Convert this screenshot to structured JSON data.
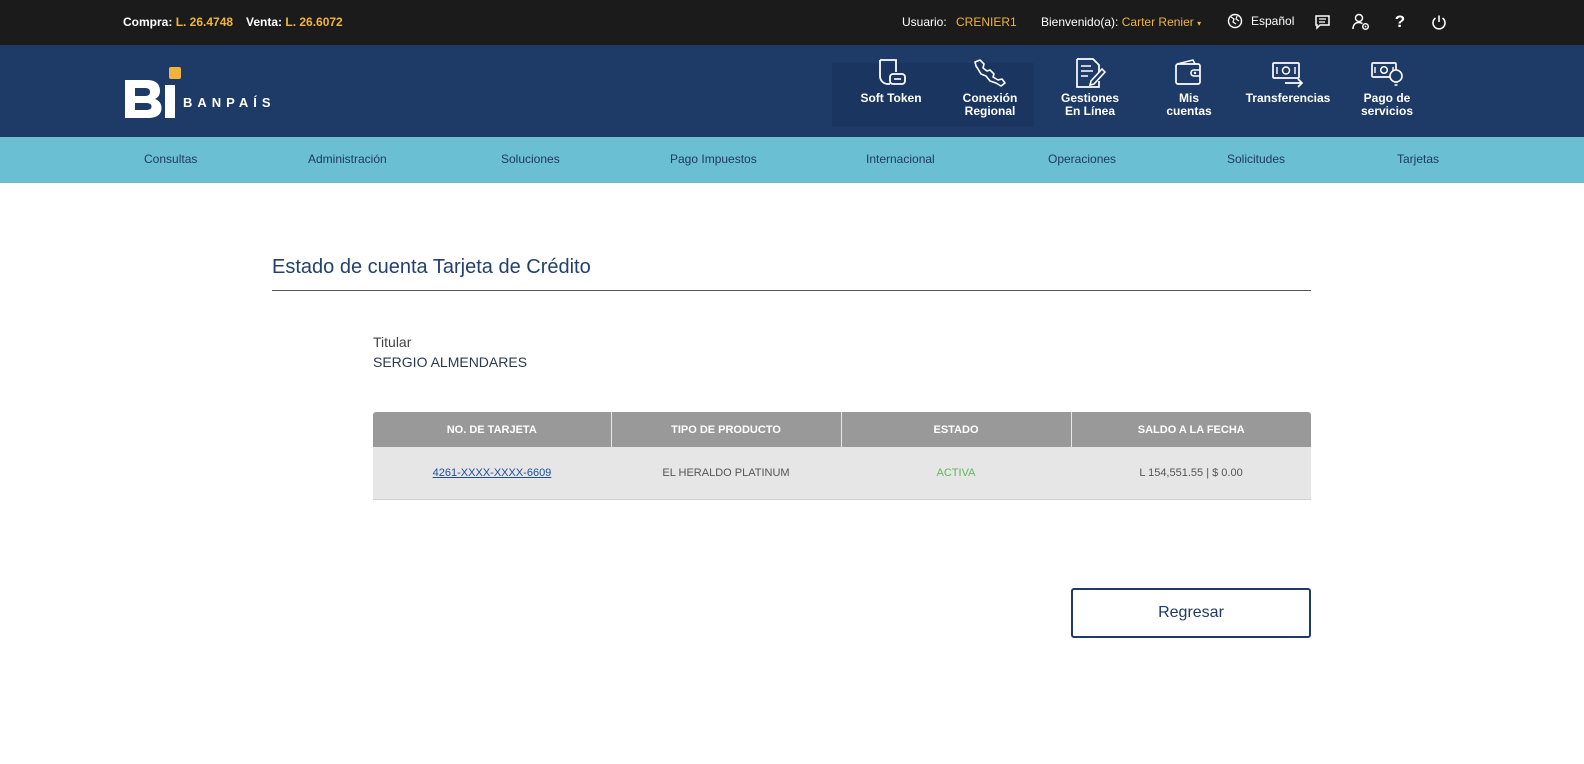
{
  "topbar": {
    "compra_label": "Compra:",
    "compra_value": "L. 26.4748",
    "venta_label": "Venta:",
    "venta_value": "L. 26.6072",
    "usuario_label": "Usuario:",
    "usuario_value": "CRENIER1",
    "bienvenido_label": "Bienvenido(a):",
    "bienvenido_name": "Carter Renier",
    "language": "Español",
    "icons": [
      "globe-icon",
      "messages-icon",
      "user-settings-icon",
      "help-icon",
      "power-icon"
    ]
  },
  "header": {
    "brand_text": "BANPAÍS",
    "quick_access": [
      {
        "label_line1": "Soft Token",
        "label_line2": "",
        "icon": "soft-token-icon"
      },
      {
        "label_line1": "Conexión",
        "label_line2": "Regional",
        "icon": "map-icon"
      },
      {
        "label_line1": "Gestiones",
        "label_line2": "En Línea",
        "icon": "document-edit-icon"
      },
      {
        "label_line1": "Mis",
        "label_line2": "cuentas",
        "icon": "wallet-icon"
      },
      {
        "label_line1": "Transferencias",
        "label_line2": "",
        "icon": "transfer-icon"
      },
      {
        "label_line1": "Pago de",
        "label_line2": "servicios",
        "icon": "bill-payment-icon"
      }
    ]
  },
  "nav": {
    "items": [
      "Consultas",
      "Administración",
      "Soluciones",
      "Pago Impuestos",
      "Internacional",
      "Operaciones",
      "Solicitudes",
      "Tarjetas"
    ]
  },
  "main": {
    "title": "Estado de cuenta Tarjeta de Crédito",
    "holder_label": "Titular",
    "holder_name": "SERGIO ALMENDARES",
    "table": {
      "headers": [
        "NO. DE TARJETA",
        "TIPO DE PRODUCTO",
        "ESTADO",
        "SALDO A LA FECHA"
      ],
      "rows": [
        {
          "card": "4261-XXXX-XXXX-6609",
          "product": "EL HERALDO PLATINUM",
          "status": "ACTIVA",
          "balance": "L 154,551.55 | $ 0.00"
        }
      ]
    },
    "back_button": "Regresar"
  },
  "colors": {
    "topbar": "#1b1b1b",
    "header": "#1e3a66",
    "nav": "#6bbfd2",
    "accent": "#f0b43c",
    "status_active": "#5cb85c"
  }
}
